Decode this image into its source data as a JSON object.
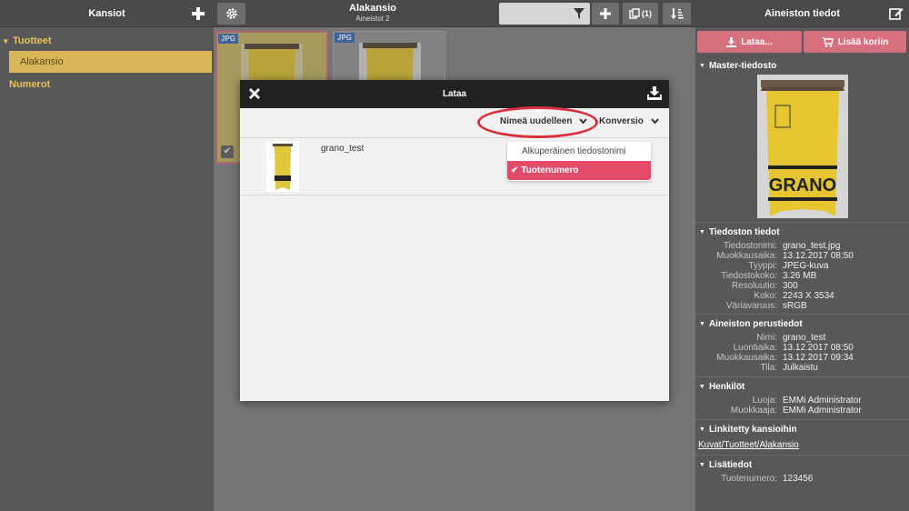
{
  "left": {
    "title": "Kansiot",
    "tree": {
      "tuotteet": "Tuotteet",
      "alakansio": "Alakansio",
      "numerot": "Numerot"
    }
  },
  "toolbar": {
    "crumb_title": "Alakansio",
    "crumb_sub": "Aineistot 2",
    "selected_count": "(1)"
  },
  "thumbs": [
    {
      "type": "JPG"
    },
    {
      "type": "JPG"
    }
  ],
  "modal": {
    "title": "Lataa",
    "rename_label": "Nimeä uudelleen",
    "conversion_label": "Konversio",
    "file_name": "grano_test",
    "rename_options": [
      "Alkuperäinen tiedostonimi",
      "Tuotenumero"
    ],
    "selected_option": "Tuotenumero"
  },
  "right": {
    "title": "Aineiston tiedot",
    "download_label": "Lataa...",
    "cart_label": "Lisää koriin",
    "sections": {
      "master": "Master-tiedosto",
      "file_info": "Tiedoston tiedot",
      "basic": "Aineiston perustiedot",
      "persons": "Henkilöt",
      "linked": "Linkitetty kansioihin",
      "extra": "Lisätiedot"
    },
    "file_info": [
      {
        "k": "Tiedostonimi:",
        "v": "grano_test.jpg"
      },
      {
        "k": "Muokkausaika:",
        "v": "13.12.2017 08:50"
      },
      {
        "k": "Tyyppi:",
        "v": "JPEG-kuva"
      },
      {
        "k": "Tiedostokoko:",
        "v": "3.26 MB"
      },
      {
        "k": "Resoluutio:",
        "v": "300"
      },
      {
        "k": "Koko:",
        "v": "2243 X 3534"
      },
      {
        "k": "Väriavaruus:",
        "v": "sRGB"
      }
    ],
    "basic": [
      {
        "k": "Nimi:",
        "v": "grano_test"
      },
      {
        "k": "Luontiaika:",
        "v": "13.12.2017 08:50"
      },
      {
        "k": "Muokkausaika:",
        "v": "13.12.2017 09:34"
      },
      {
        "k": "Tila:",
        "v": "Julkaistu"
      }
    ],
    "persons": [
      {
        "k": "Luoja:",
        "v": "EMMi Administrator"
      },
      {
        "k": "Muokkaaja:",
        "v": "EMMi Administrator"
      }
    ],
    "linked_path": "Kuvat/Tuotteet/Alakansio",
    "extra": [
      {
        "k": "Tuotenumero:",
        "v": "123456"
      }
    ]
  },
  "product_label": "GRANO",
  "colors": {
    "accent": "#d7707d",
    "selected": "#e34b68",
    "folder": "#e8c15a",
    "highlight": "#d8313c"
  }
}
